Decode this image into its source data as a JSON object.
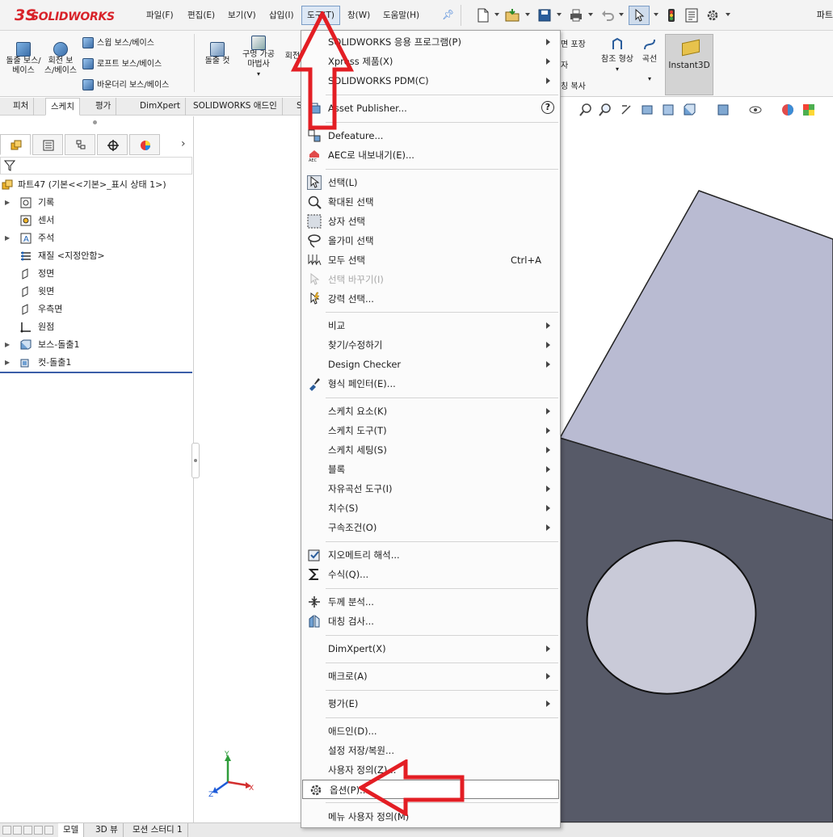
{
  "app": {
    "logo_ds": "3S",
    "logo_text": "SOLIDWORKS",
    "document_title": "파트"
  },
  "menubar": {
    "items": [
      {
        "label": "파일(F)"
      },
      {
        "label": "편집(E)"
      },
      {
        "label": "보기(V)"
      },
      {
        "label": "삽입(I)"
      },
      {
        "label": "도구(T)"
      },
      {
        "label": "창(W)"
      },
      {
        "label": "도움말(H)"
      }
    ]
  },
  "command_manager": {
    "big_buttons": [
      {
        "label": "돌출 보스/베이스"
      },
      {
        "label": "회전 보스/베이스"
      },
      {
        "label": "돌출 컷"
      },
      {
        "label": "구멍 가공 마법사"
      },
      {
        "label": "회전"
      },
      {
        "label": "참조 형상"
      },
      {
        "label": "곡선"
      },
      {
        "label": "Instant3D"
      }
    ],
    "small_buttons": [
      {
        "label": "스윕 보스/베이스"
      },
      {
        "label": "로프트 보스/베이스"
      },
      {
        "label": "바운더리 보스/베이스"
      },
      {
        "label": "면 포장"
      },
      {
        "label": "자"
      },
      {
        "label": "칭 복사"
      }
    ],
    "tabs": [
      {
        "label": "피처"
      },
      {
        "label": "스케치"
      },
      {
        "label": "평가"
      },
      {
        "label": "DimXpert"
      },
      {
        "label": "SOLIDWORKS 애드인"
      },
      {
        "label": "S"
      }
    ]
  },
  "feature_tree": {
    "root": "파트47  (기본<<기본>_표시 상태 1>)",
    "items": [
      {
        "label": "기록",
        "expandable": true
      },
      {
        "label": "센서",
        "expandable": false
      },
      {
        "label": "주석",
        "expandable": true
      },
      {
        "label": "재질 <지정안함>",
        "expandable": false
      },
      {
        "label": "정면",
        "expandable": false
      },
      {
        "label": "윗면",
        "expandable": false
      },
      {
        "label": "우측면",
        "expandable": false
      },
      {
        "label": "원점",
        "expandable": false
      },
      {
        "label": "보스-돌출1",
        "expandable": true
      },
      {
        "label": "컷-돌출1",
        "expandable": true
      }
    ]
  },
  "bottom_tabs": [
    {
      "label": "모델"
    },
    {
      "label": "3D 뷰"
    },
    {
      "label": "모션 스터디 1"
    }
  ],
  "triad": {
    "x": "X",
    "y": "Y",
    "z": "Z"
  },
  "tools_menu": {
    "items": [
      {
        "label": "SOLIDWORKS 응용 프로그램(P)",
        "submenu": true
      },
      {
        "label": "Xpress 제품(X)",
        "submenu": true
      },
      {
        "label": "SOLIDWORKS PDM(C)",
        "submenu": true
      },
      {
        "label": "Asset Publisher...",
        "help": "?"
      },
      {
        "label": "Defeature..."
      },
      {
        "label": "AEC로 내보내기(E)..."
      },
      {
        "label": "선택(L)"
      },
      {
        "label": "확대된 선택"
      },
      {
        "label": "상자 선택"
      },
      {
        "label": "올가미 선택"
      },
      {
        "label": "모두 선택",
        "shortcut": "Ctrl+A"
      },
      {
        "label": "선택 바꾸기(I)",
        "disabled": true
      },
      {
        "label": "강력 선택..."
      },
      {
        "label": "비교",
        "submenu": true
      },
      {
        "label": "찾기/수정하기",
        "submenu": true
      },
      {
        "label": "Design Checker",
        "submenu": true
      },
      {
        "label": "형식 페인터(E)..."
      },
      {
        "label": "스케치 요소(K)",
        "submenu": true
      },
      {
        "label": "스케치 도구(T)",
        "submenu": true
      },
      {
        "label": "스케치 세팅(S)",
        "submenu": true
      },
      {
        "label": "블록",
        "submenu": true
      },
      {
        "label": "자유곡선 도구(I)",
        "submenu": true
      },
      {
        "label": "치수(S)",
        "submenu": true
      },
      {
        "label": "구속조건(O)",
        "submenu": true
      },
      {
        "label": "지오메트리 해석..."
      },
      {
        "label": "수식(Q)..."
      },
      {
        "label": "두께 분석..."
      },
      {
        "label": "대칭 검사..."
      },
      {
        "label": "DimXpert(X)",
        "submenu": true
      },
      {
        "label": "매크로(A)",
        "submenu": true
      },
      {
        "label": "평가(E)",
        "submenu": true
      },
      {
        "label": "애드인(D)..."
      },
      {
        "label": "설정 저장/복원..."
      },
      {
        "label": "사용자 정의(Z)..."
      },
      {
        "label": "옵션(P)..."
      },
      {
        "label": "메뉴 사용자 정의(M)"
      }
    ]
  },
  "colors": {
    "accent_red": "#e31e24",
    "model_top": "#b9bbd2",
    "model_front": "#575a68",
    "hole": "#c9cad8"
  }
}
